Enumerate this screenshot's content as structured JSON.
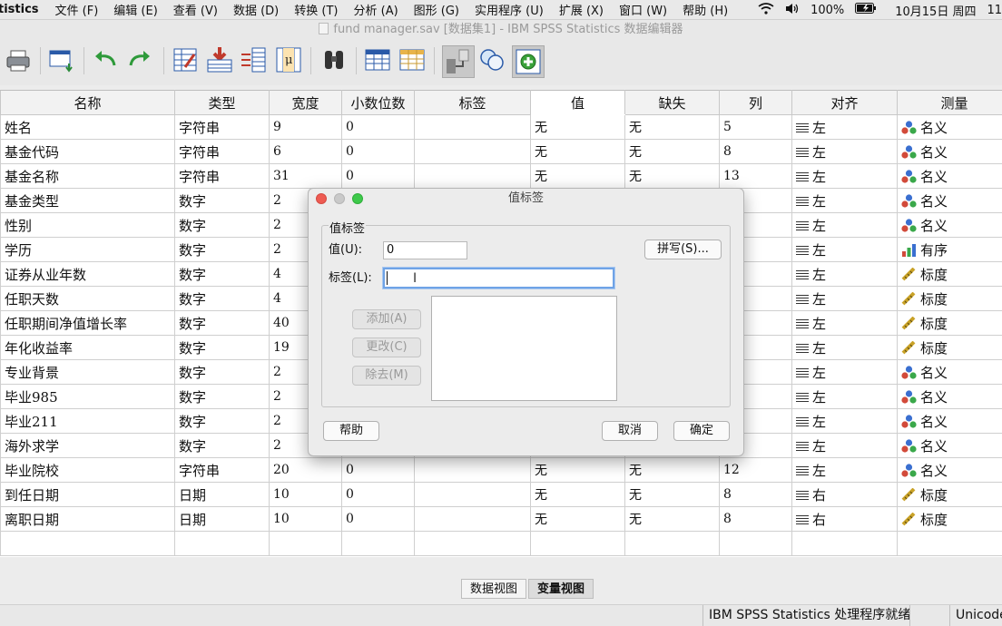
{
  "menubar": {
    "app_name": "tistics",
    "items": [
      "文件 (F)",
      "编辑 (E)",
      "查看 (V)",
      "数据 (D)",
      "转换 (T)",
      "分析 (A)",
      "图形 (G)",
      "实用程序 (U)",
      "扩展 (X)",
      "窗口 (W)",
      "帮助 (H)"
    ],
    "battery": "100%",
    "datetime": "10月15日 周四",
    "clock": "11"
  },
  "window": {
    "title": "fund manager.sav [数据集1] - IBM SPSS Statistics 数据编辑器"
  },
  "toolbar": {
    "icons": [
      "print-icon",
      "recall-dialog-icon",
      "undo-icon",
      "redo-icon",
      "goto-case-icon",
      "goto-variable-icon",
      "variables-icon",
      "run-descriptives-icon",
      "find-icon",
      "insert-cases-icon",
      "insert-variable-icon",
      "split-file-icon",
      "value-labels-icon",
      "add-on-icon"
    ]
  },
  "grid": {
    "columns": [
      "名称",
      "类型",
      "宽度",
      "小数位数",
      "标签",
      "值",
      "缺失",
      "列",
      "对齐",
      "测量"
    ],
    "selected_column": "值",
    "rows": [
      {
        "name": "姓名",
        "type": "字符串",
        "width": "9",
        "decimals": "0",
        "label": "",
        "values": "无",
        "missing": "无",
        "columns": "5",
        "align": "左",
        "measure": "名义",
        "measure_icon": "nominal-icon"
      },
      {
        "name": "基金代码",
        "type": "字符串",
        "width": "6",
        "decimals": "0",
        "label": "",
        "values": "无",
        "missing": "无",
        "columns": "8",
        "align": "左",
        "measure": "名义",
        "measure_icon": "nominal-icon"
      },
      {
        "name": "基金名称",
        "type": "字符串",
        "width": "31",
        "decimals": "0",
        "label": "",
        "values": "无",
        "missing": "无",
        "columns": "13",
        "align": "左",
        "measure": "名义",
        "measure_icon": "nominal-icon"
      },
      {
        "name": "基金类型",
        "type": "数字",
        "width": "2",
        "decimals": "",
        "label": "",
        "values": "",
        "missing": "",
        "columns": "",
        "align": "左",
        "measure": "名义",
        "measure_icon": "nominal-icon"
      },
      {
        "name": "性别",
        "type": "数字",
        "width": "2",
        "decimals": "",
        "label": "",
        "values": "",
        "missing": "",
        "columns": "",
        "align": "左",
        "measure": "名义",
        "measure_icon": "nominal-icon"
      },
      {
        "name": "学历",
        "type": "数字",
        "width": "2",
        "decimals": "",
        "label": "",
        "values": "",
        "missing": "",
        "columns": "",
        "align": "左",
        "measure": "有序",
        "measure_icon": "ordinal-icon"
      },
      {
        "name": "证券从业年数",
        "type": "数字",
        "width": "4",
        "decimals": "",
        "label": "",
        "values": "",
        "missing": "",
        "columns": "",
        "align": "左",
        "measure": "标度",
        "measure_icon": "scale-icon"
      },
      {
        "name": "任职天数",
        "type": "数字",
        "width": "4",
        "decimals": "",
        "label": "",
        "values": "",
        "missing": "",
        "columns": "",
        "align": "左",
        "measure": "标度",
        "measure_icon": "scale-icon"
      },
      {
        "name": "任职期间净值增长率",
        "type": "数字",
        "width": "40",
        "decimals": "",
        "label": "",
        "values": "",
        "missing": "",
        "columns": "",
        "align": "左",
        "measure": "标度",
        "measure_icon": "scale-icon"
      },
      {
        "name": "年化收益率",
        "type": "数字",
        "width": "19",
        "decimals": "",
        "label": "",
        "values": "",
        "missing": "",
        "columns": "",
        "align": "左",
        "measure": "标度",
        "measure_icon": "scale-icon"
      },
      {
        "name": "专业背景",
        "type": "数字",
        "width": "2",
        "decimals": "",
        "label": "",
        "values": "",
        "missing": "",
        "columns": "",
        "align": "左",
        "measure": "名义",
        "measure_icon": "nominal-icon"
      },
      {
        "name": "毕业985",
        "type": "数字",
        "width": "2",
        "decimals": "",
        "label": "",
        "values": "",
        "missing": "",
        "columns": "",
        "align": "左",
        "measure": "名义",
        "measure_icon": "nominal-icon"
      },
      {
        "name": "毕业211",
        "type": "数字",
        "width": "2",
        "decimals": "",
        "label": "",
        "values": "",
        "missing": "",
        "columns": "",
        "align": "左",
        "measure": "名义",
        "measure_icon": "nominal-icon"
      },
      {
        "name": "海外求学",
        "type": "数字",
        "width": "2",
        "decimals": "",
        "label": "",
        "values": "",
        "missing": "",
        "columns": "",
        "align": "左",
        "measure": "名义",
        "measure_icon": "nominal-icon"
      },
      {
        "name": "毕业院校",
        "type": "字符串",
        "width": "20",
        "decimals": "0",
        "label": "",
        "values": "无",
        "missing": "无",
        "columns": "12",
        "align": "左",
        "measure": "名义",
        "measure_icon": "nominal-icon"
      },
      {
        "name": "到任日期",
        "type": "日期",
        "width": "10",
        "decimals": "0",
        "label": "",
        "values": "无",
        "missing": "无",
        "columns": "8",
        "align": "右",
        "measure": "标度",
        "measure_icon": "scale-icon"
      },
      {
        "name": "离职日期",
        "type": "日期",
        "width": "10",
        "decimals": "0",
        "label": "",
        "values": "无",
        "missing": "无",
        "columns": "8",
        "align": "右",
        "measure": "标度",
        "measure_icon": "scale-icon"
      }
    ]
  },
  "dialog": {
    "title": "值标签",
    "group_label": "值标签",
    "value_label": "值(U):",
    "value": "0",
    "label_label": "标签(L):",
    "label_value": "",
    "spelling_button": "拼写(S)...",
    "add_button": "添加(A)",
    "change_button": "更改(C)",
    "remove_button": "除去(M)",
    "help_button": "帮助",
    "cancel_button": "取消",
    "ok_button": "确定"
  },
  "bottom": {
    "data_view_tab": "数据视图",
    "variable_view_tab": "变量视图",
    "status": "IBM SPSS Statistics 处理程序就绪",
    "encoding": "Unicode"
  },
  "colors": {
    "focus_ring": "#6fa3e6",
    "close_light": "#ee5b52",
    "min_light": "#c9c9c9",
    "max_light": "#3ec94b"
  }
}
